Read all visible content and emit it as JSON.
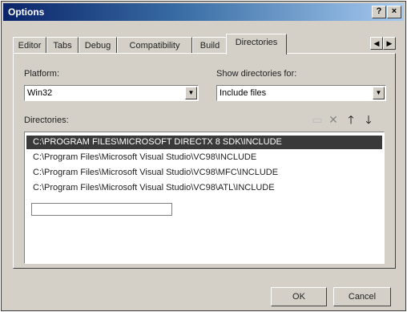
{
  "window": {
    "title": "Options",
    "help_label": "?",
    "close_label": "×"
  },
  "tabs": [
    {
      "label": "Editor"
    },
    {
      "label": "Tabs"
    },
    {
      "label": "Debug"
    },
    {
      "label": "Compatibility"
    },
    {
      "label": "Build"
    },
    {
      "label": "Directories"
    }
  ],
  "platform": {
    "label": "Platform:",
    "value": "Win32"
  },
  "show_dirs": {
    "label": "Show directories for:",
    "value": "Include files"
  },
  "directories": {
    "label": "Directories:",
    "items": [
      "C:\\PROGRAM FILES\\MICROSOFT DIRECTX 8 SDK\\INCLUDE",
      "C:\\Program Files\\Microsoft Visual Studio\\VC98\\INCLUDE",
      "C:\\Program Files\\Microsoft Visual Studio\\VC98\\MFC\\INCLUDE",
      "C:\\Program Files\\Microsoft Visual Studio\\VC98\\ATL\\INCLUDE"
    ]
  },
  "buttons": {
    "ok": "OK",
    "cancel": "Cancel"
  },
  "icons": {
    "new": "new-folder-icon",
    "delete": "delete-icon",
    "up": "move-up-icon",
    "down": "move-down-icon"
  }
}
